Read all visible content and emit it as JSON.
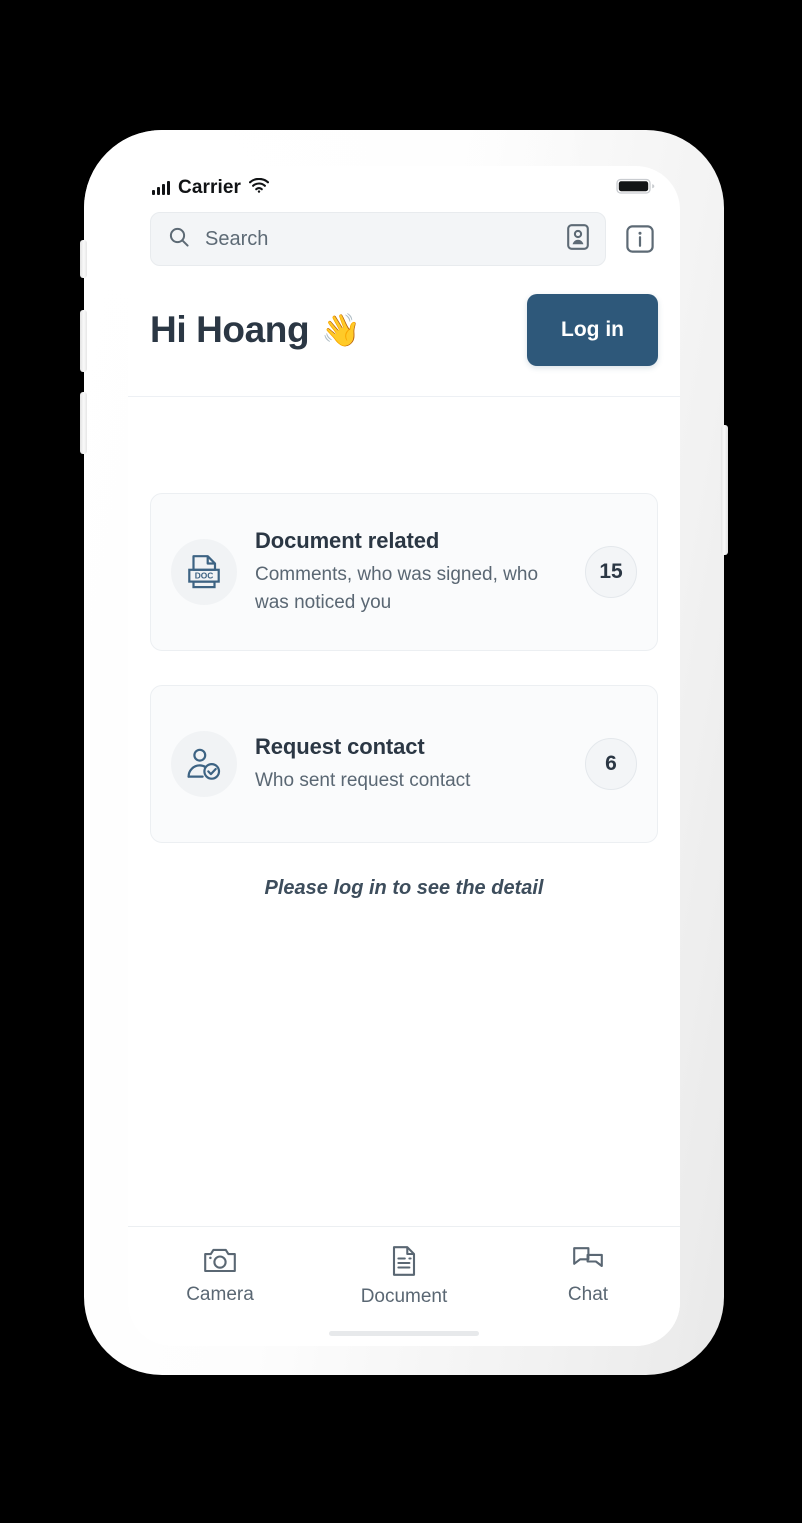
{
  "statusbar": {
    "carrier": "Carrier",
    "signal_icon": "signal-bars-icon",
    "wifi_icon": "wifi-icon",
    "battery_icon": "battery-icon"
  },
  "header": {
    "search": {
      "placeholder": "Search",
      "search_icon": "search-icon",
      "contact_card_icon": "contact-card-icon"
    },
    "info_icon": "info-icon",
    "greeting": "Hi Hoang",
    "greeting_emoji": "👋",
    "login_label": "Log in"
  },
  "cards": [
    {
      "icon": "doc-file-icon",
      "icon_text": "DOC",
      "title": "Document related",
      "subtitle": "Comments, who was signed, who was noticed you",
      "badge": "15"
    },
    {
      "icon": "user-check-icon",
      "title": "Request contact",
      "subtitle": "Who sent request contact",
      "badge": "6"
    }
  ],
  "hint": "Please log in to see the detail",
  "tabbar": {
    "items": [
      {
        "label": "Camera",
        "icon": "camera-icon"
      },
      {
        "label": "Document",
        "icon": "document-icon"
      },
      {
        "label": "Chat",
        "icon": "chat-icon"
      }
    ]
  },
  "colors": {
    "accent_blue": "#2e587a",
    "icon_steel": "#3d6383",
    "text_dark": "#2b3744",
    "text_muted": "#5a6773",
    "card_bg": "#fafbfc",
    "search_bg": "#f3f5f7"
  }
}
